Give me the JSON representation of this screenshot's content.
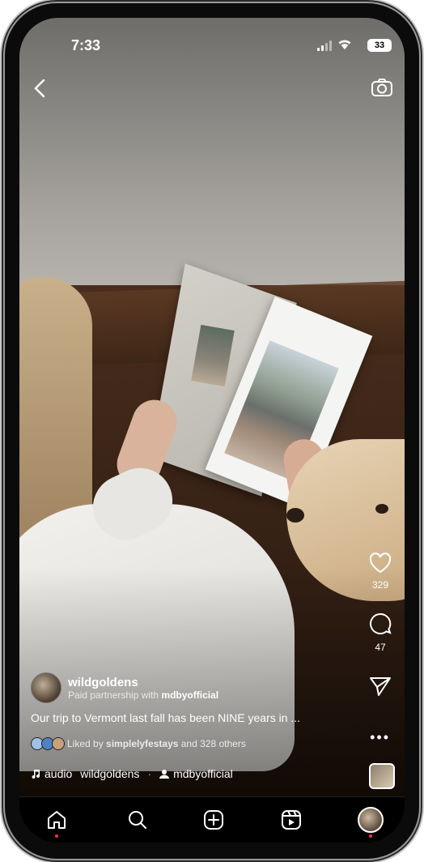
{
  "status_bar": {
    "time": "7:33",
    "battery": "33"
  },
  "post": {
    "username": "wildgoldens",
    "partnership_prefix": "Paid partnership with ",
    "partner": "mdbyofficial",
    "caption": "Our trip to Vermont last fall has been NINE years in ...",
    "liked_prefix": "Liked by ",
    "liked_user": "simplelyfestays",
    "liked_suffix": " and 328 others"
  },
  "actions": {
    "likes": "329",
    "comments": "47"
  },
  "audio": {
    "label": "audio",
    "author": "wildgoldens",
    "tagged": "mdbyofficial"
  },
  "icons": {
    "back": "chevron-left-icon",
    "camera": "camera-icon",
    "heart": "heart-icon",
    "comment": "comment-icon",
    "share": "paper-plane-icon",
    "more": "more-horizontal-icon",
    "music": "music-note-icon",
    "person": "person-icon",
    "nav": [
      "home-icon",
      "search-icon",
      "create-icon",
      "reels-icon",
      "profile-avatar"
    ]
  },
  "colors": {
    "notification_dot": "#ff3040"
  }
}
